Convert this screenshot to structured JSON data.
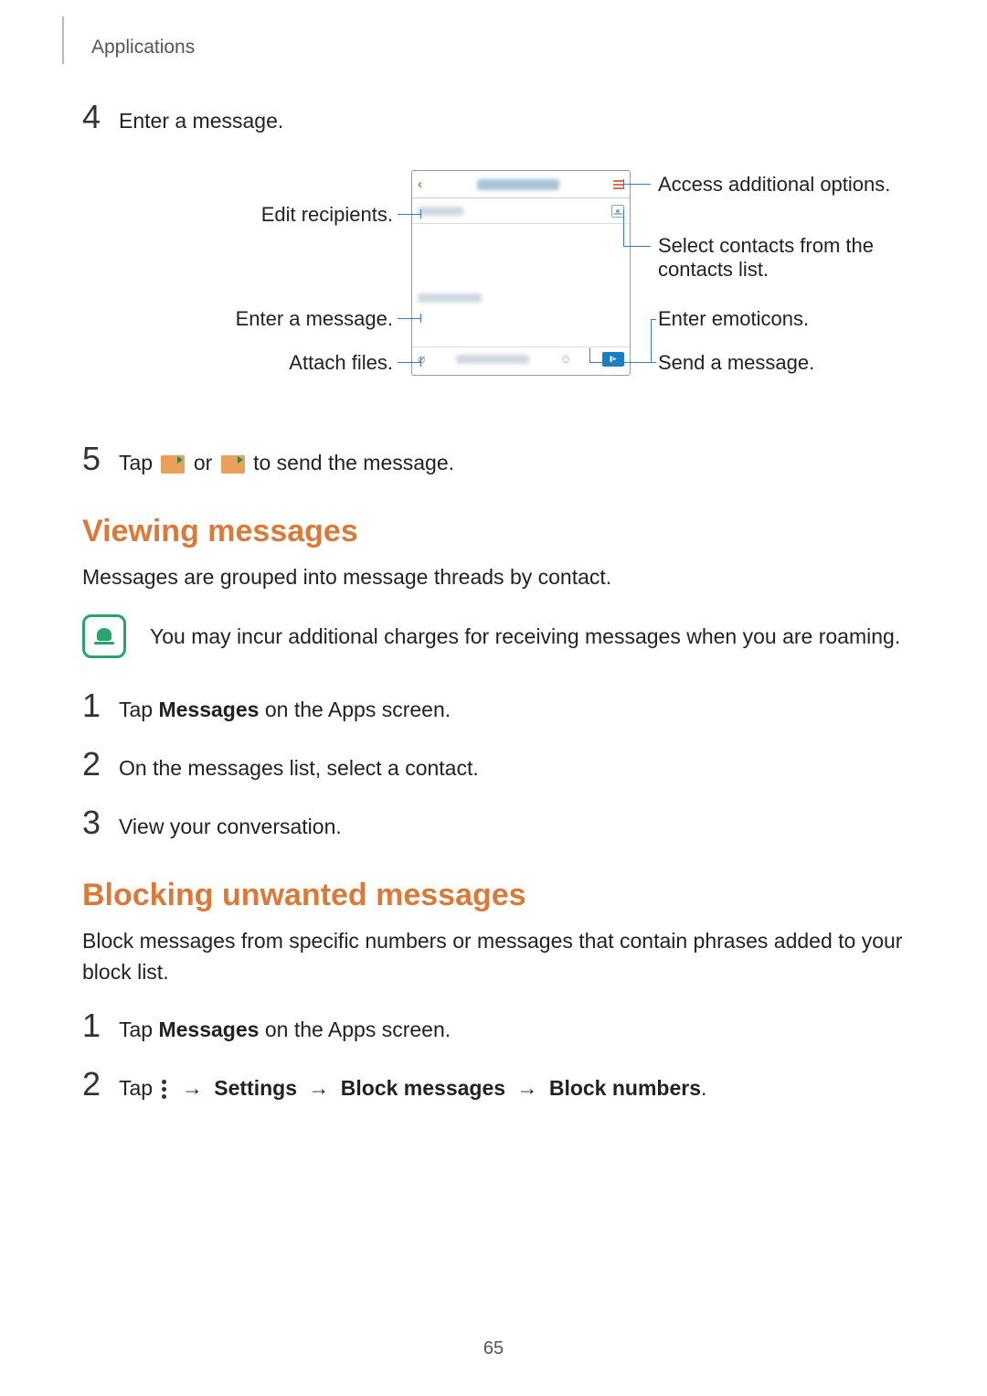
{
  "section_label": "Applications",
  "step4": {
    "num": "4",
    "text": "Enter a message."
  },
  "diagram": {
    "left": {
      "edit_recipients": "Edit recipients.",
      "enter_message": "Enter a message.",
      "attach_files": "Attach files."
    },
    "right": {
      "additional_options": "Access additional options.",
      "select_contacts_l1": "Select contacts from the",
      "select_contacts_l2": "contacts list.",
      "enter_emoticons": "Enter emoticons.",
      "send_message": "Send a message."
    }
  },
  "step5": {
    "num": "5",
    "pre": "Tap ",
    "mid": " or ",
    "post": " to send the message."
  },
  "viewing": {
    "heading": "Viewing messages",
    "intro": "Messages are grouped into message threads by contact.",
    "note": "You may incur additional charges for receiving messages when you are roaming.",
    "s1": {
      "num": "1",
      "pre": "Tap ",
      "bold": "Messages",
      "post": " on the Apps screen."
    },
    "s2": {
      "num": "2",
      "text": "On the messages list, select a contact."
    },
    "s3": {
      "num": "3",
      "text": "View your conversation."
    }
  },
  "blocking": {
    "heading": "Blocking unwanted messages",
    "intro": "Block messages from specific numbers or messages that contain phrases added to your block list.",
    "s1": {
      "num": "1",
      "pre": "Tap ",
      "bold": "Messages",
      "post": " on the Apps screen."
    },
    "s2": {
      "num": "2",
      "pre": "Tap ",
      "arrow": " → ",
      "settings": "Settings",
      "block_messages": "Block messages",
      "block_numbers": "Block numbers",
      "dot": "."
    }
  },
  "page_number": "65"
}
